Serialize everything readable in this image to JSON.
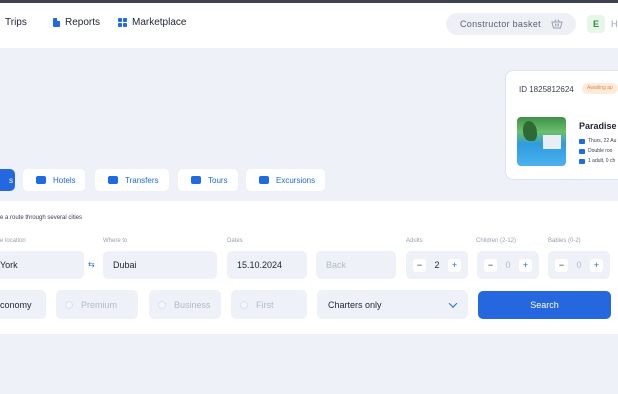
{
  "nav": {
    "trips": "Trips",
    "reports": "Reports",
    "marketplace": "Marketplace",
    "basket": "Constructor basket",
    "avatar_letter": "E",
    "user_name": "Hi"
  },
  "order": {
    "id": "ID 1825812624",
    "status": "Awaiting ap",
    "hotel": "Paradise V",
    "dates": "Thurs, 22 Au",
    "room": "Double roo",
    "guests": "1 adult, 0 ch"
  },
  "tabs": [
    {
      "label": "s",
      "active": true,
      "icon": "plane-icon"
    },
    {
      "label": "Hotels",
      "icon": "bed-icon"
    },
    {
      "label": "Transfers",
      "icon": "car-icon"
    },
    {
      "label": "Tours",
      "icon": "palm-icon"
    },
    {
      "label": "Excursions",
      "icon": "ticket-icon"
    }
  ],
  "form": {
    "route_note": "e a route through several cities",
    "labels": {
      "from": "e location",
      "to": "Where to",
      "dates": "Dates",
      "adults": "Adults",
      "children": "Children (2-12)",
      "babies": "Babies (0-2)"
    },
    "from_value": "York",
    "to_value": "Dubai",
    "date_value": "15.10.2024",
    "back_placeholder": "Back",
    "adults": "2",
    "children": "0",
    "babies": "0",
    "classes": [
      "conomy",
      "Premium",
      "Business",
      "First"
    ],
    "charter_select": "Charters only",
    "search_label": "Search",
    "minus": "−",
    "plus": "+",
    "swap": "⇆"
  },
  "colors": {
    "accent": "#2467de",
    "background": "#eef1f8",
    "status_badge": "#e68a45"
  }
}
